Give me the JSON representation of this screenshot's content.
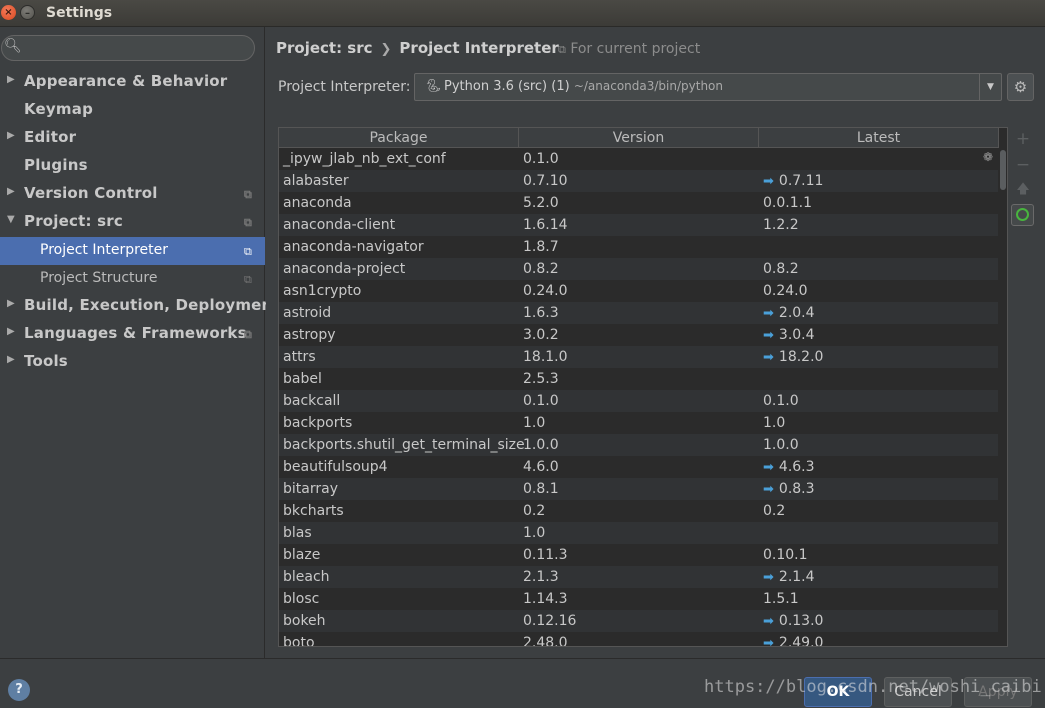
{
  "window": {
    "title": "Settings"
  },
  "sidebar": {
    "items": [
      {
        "label": "Appearance & Behavior"
      },
      {
        "label": "Keymap"
      },
      {
        "label": "Editor"
      },
      {
        "label": "Plugins"
      },
      {
        "label": "Version Control"
      },
      {
        "label": "Project: src"
      },
      {
        "label": "Project Interpreter"
      },
      {
        "label": "Project Structure"
      },
      {
        "label": "Build, Execution, Deployment"
      },
      {
        "label": "Languages & Frameworks"
      },
      {
        "label": "Tools"
      }
    ]
  },
  "header": {
    "crumb_project": "Project: src",
    "crumb_page": "Project Interpreter",
    "for_current": "For current project"
  },
  "interpreter": {
    "label": "Project Interpreter:",
    "name": "Python 3.6 (src) (1)",
    "path": "~/anaconda3/bin/python"
  },
  "table": {
    "headers": [
      "Package",
      "Version",
      "Latest"
    ],
    "rows": [
      [
        "_ipyw_jlab_nb_ext_conf",
        "0.1.0",
        ""
      ],
      [
        "alabaster",
        "0.7.10",
        "0.7.11"
      ],
      [
        "anaconda",
        "5.2.0",
        "0.0.1.1"
      ],
      [
        "anaconda-client",
        "1.6.14",
        "1.2.2"
      ],
      [
        "anaconda-navigator",
        "1.8.7",
        ""
      ],
      [
        "anaconda-project",
        "0.8.2",
        "0.8.2"
      ],
      [
        "asn1crypto",
        "0.24.0",
        "0.24.0"
      ],
      [
        "astroid",
        "1.6.3",
        "2.0.4"
      ],
      [
        "astropy",
        "3.0.2",
        "3.0.4"
      ],
      [
        "attrs",
        "18.1.0",
        "18.2.0"
      ],
      [
        "babel",
        "2.5.3",
        ""
      ],
      [
        "backcall",
        "0.1.0",
        "0.1.0"
      ],
      [
        "backports",
        "1.0",
        "1.0"
      ],
      [
        "backports.shutil_get_terminal_size",
        "1.0.0",
        "1.0.0"
      ],
      [
        "beautifulsoup4",
        "4.6.0",
        "4.6.3"
      ],
      [
        "bitarray",
        "0.8.1",
        "0.8.3"
      ],
      [
        "bkcharts",
        "0.2",
        "0.2"
      ],
      [
        "blas",
        "1.0",
        ""
      ],
      [
        "blaze",
        "0.11.3",
        "0.10.1"
      ],
      [
        "bleach",
        "2.1.3",
        "2.1.4"
      ],
      [
        "blosc",
        "1.14.3",
        "1.5.1"
      ],
      [
        "bokeh",
        "0.12.16",
        "0.13.0"
      ],
      [
        "boto",
        "2.48.0",
        "2.49.0"
      ]
    ],
    "upgrade_rows": [
      1,
      7,
      8,
      9,
      14,
      15,
      19,
      21,
      22
    ]
  },
  "footer": {
    "help": "?",
    "ok": "OK",
    "cancel": "Cancel",
    "apply": "Apply",
    "watermark": "https://blog.csdn.net/woshi_caibi"
  },
  "colors": {
    "accent": "#4b6eaf",
    "upgrade_arrow": "#4aa0d9",
    "conda_green": "#48b53e"
  }
}
